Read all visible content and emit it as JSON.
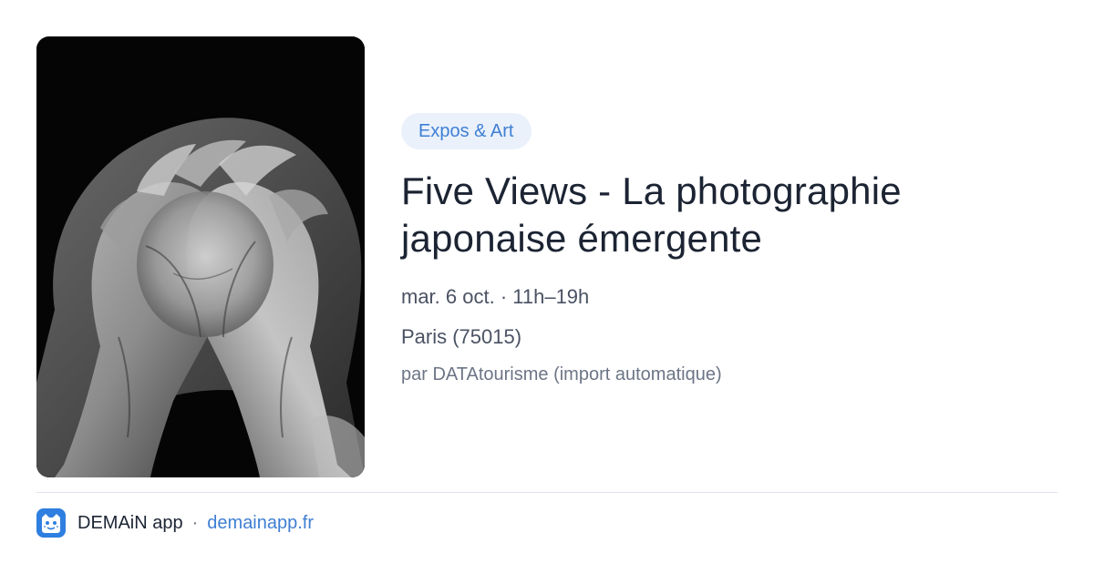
{
  "event": {
    "category": "Expos & Art",
    "title": "Five Views - La photographie japonaise émergente",
    "date": "mar. 6 oct. · 11h–19h",
    "location": "Paris (75015)",
    "source": "par DATAtourisme (import automatique)"
  },
  "image": {
    "subject": "black-and-white photograph of cupped hands"
  },
  "footer": {
    "app_name": "DEMAiN app",
    "separator": "·",
    "link": "demainapp.fr",
    "logo_icon": "demain-app-logo-icon"
  },
  "colors": {
    "accent": "#3f7fd3",
    "pill_background": "#eaf1fb",
    "title": "#1c2433",
    "secondary_text": "#4a5263",
    "muted_text": "#6c7586",
    "logo_background": "#2f7fe0"
  }
}
